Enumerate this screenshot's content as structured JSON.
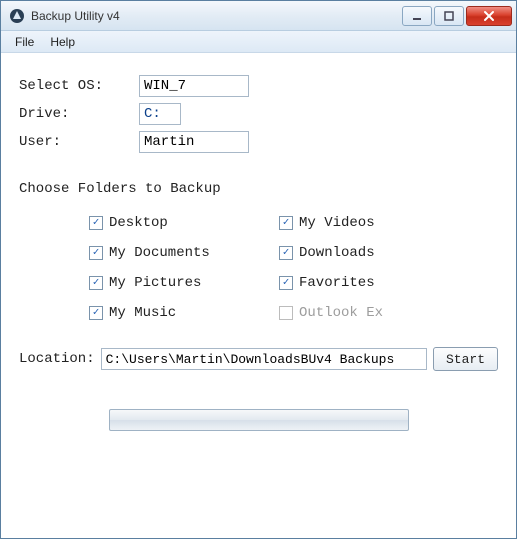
{
  "window": {
    "title": "Backup Utility v4"
  },
  "menu": {
    "file": "File",
    "help": "Help"
  },
  "form": {
    "os_label": "Select OS:",
    "os_value": "WIN_7",
    "drive_label": "Drive:",
    "drive_value": "C:",
    "user_label": "User:",
    "user_value": "Martin"
  },
  "folders": {
    "title": "Choose Folders to Backup",
    "items": [
      {
        "label": "Desktop",
        "checked": true,
        "enabled": true
      },
      {
        "label": "My Videos",
        "checked": true,
        "enabled": true
      },
      {
        "label": "My Documents",
        "checked": true,
        "enabled": true
      },
      {
        "label": "Downloads",
        "checked": true,
        "enabled": true
      },
      {
        "label": "My Pictures",
        "checked": true,
        "enabled": true
      },
      {
        "label": "Favorites",
        "checked": true,
        "enabled": true
      },
      {
        "label": "My Music",
        "checked": true,
        "enabled": true
      },
      {
        "label": "Outlook Ex",
        "checked": false,
        "enabled": false
      }
    ]
  },
  "location": {
    "label": "Location:",
    "value": "C:\\Users\\Martin\\DownloadsBUv4 Backups",
    "start_label": "Start"
  }
}
